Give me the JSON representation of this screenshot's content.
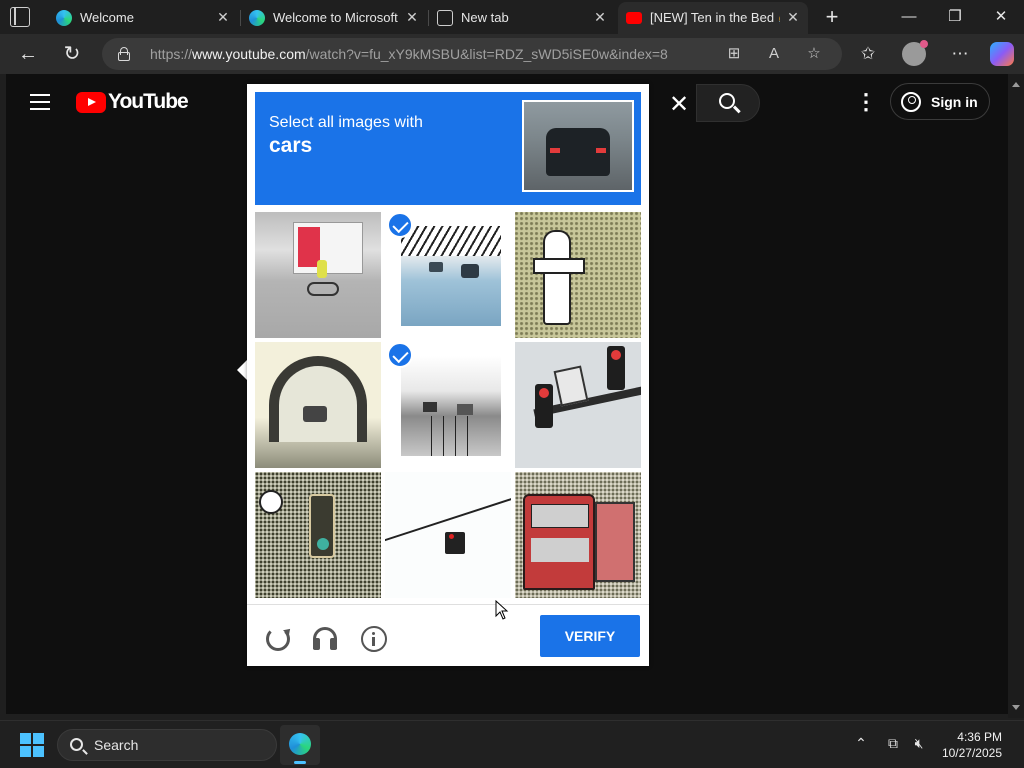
{
  "browser": {
    "tabs": [
      {
        "title": "Welcome",
        "favicon": "edge-icon"
      },
      {
        "title": "Welcome to Microsoft Ed",
        "favicon": "edge-icon"
      },
      {
        "title": "New tab",
        "favicon": "new-tab-icon"
      },
      {
        "title": "[NEW] Ten in the Bed 🥳",
        "favicon": "youtube-icon",
        "active": true
      }
    ],
    "url_prefix": "https://",
    "url_domain": "www.youtube.com",
    "url_path": "/watch?v=fu_xY9kMSBU&list=RDZ_sWD5iSE0w&index=8"
  },
  "youtube": {
    "logo_text": "YouTube",
    "signin_label": "Sign in"
  },
  "captcha": {
    "instruction": "Select all images with",
    "target": "cars",
    "verify_label": "VERIFY",
    "selected_color": "#1a73e8",
    "tiles": [
      {
        "selected": false
      },
      {
        "selected": true
      },
      {
        "selected": false
      },
      {
        "selected": false
      },
      {
        "selected": true
      },
      {
        "selected": false
      },
      {
        "selected": false
      },
      {
        "selected": false
      },
      {
        "selected": false
      }
    ]
  },
  "taskbar": {
    "search_label": "Search",
    "time": "4:36 PM",
    "date": "10/27/2025"
  }
}
